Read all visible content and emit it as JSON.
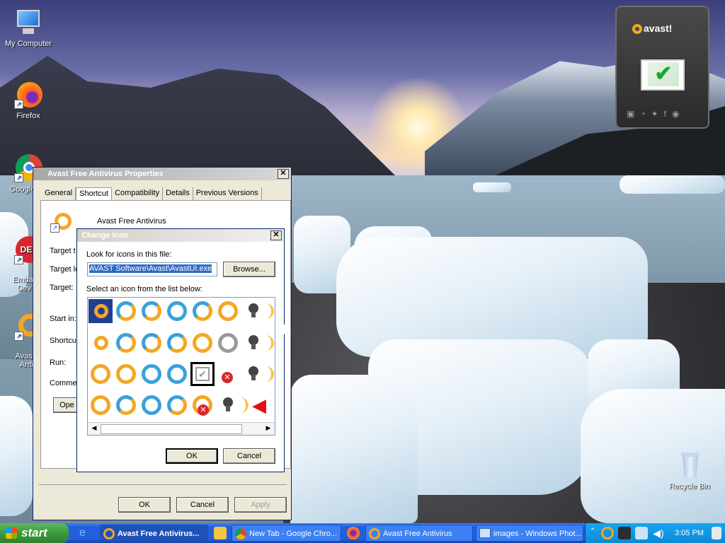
{
  "desktop": {
    "icons": [
      {
        "label": "My Computer"
      },
      {
        "label": "Firefox"
      },
      {
        "label": "Google Ch"
      },
      {
        "label": "Embarca\nDev-C"
      },
      {
        "label": "Avast F\nAntiv"
      },
      {
        "label": "Recycle Bin"
      }
    ]
  },
  "gadget": {
    "brand": "avast!"
  },
  "properties_dialog": {
    "title": "Avast Free Antivirus Properties",
    "tabs": [
      "General",
      "Shortcut",
      "Compatibility",
      "Details",
      "Previous Versions"
    ],
    "active_tab": "Shortcut",
    "app_name": "Avast Free Antivirus",
    "field_labels": {
      "target_type": "Target t",
      "target_location": "Target lo",
      "target": "Target:",
      "start_in": "Start in:",
      "shortcut_key": "Shortcut",
      "run": "Run:",
      "comment": "Commen"
    },
    "open_button": "Ope",
    "ok": "OK",
    "cancel": "Cancel",
    "apply": "Apply"
  },
  "change_icon_dialog": {
    "title": "Change Icon",
    "look_for_label": "Look for icons in this file:",
    "file_value": "AVAST Software\\Avast\\AvastUI.exe",
    "browse": "Browse...",
    "select_label": "Select an icon from the list below:",
    "ok": "OK",
    "cancel": "Cancel"
  },
  "taskbar": {
    "start": "start",
    "buttons": [
      {
        "label": "Avast Free Antivirus..."
      },
      {
        "label": "New Tab - Google Chro..."
      },
      {
        "label": "Avast Free Antivirus"
      },
      {
        "label": "images - Windows Phot..."
      }
    ],
    "clock": "3:05 PM"
  }
}
